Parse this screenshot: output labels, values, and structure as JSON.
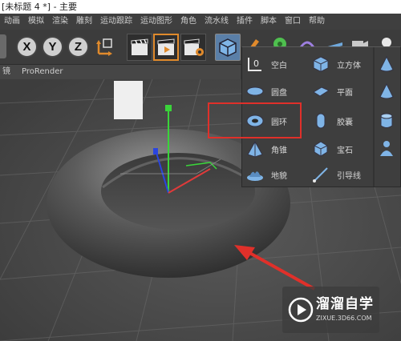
{
  "window": {
    "title": "[未标题 4 *] - 主要"
  },
  "menubar": {
    "items": [
      "动画",
      "模拟",
      "渲染",
      "雕刻",
      "运动跟踪",
      "运动图形",
      "角色",
      "流水线",
      "插件",
      "脚本",
      "窗口",
      "帮助"
    ]
  },
  "toolbar": {
    "axis_x": "X",
    "axis_y": "Y",
    "axis_z": "Z"
  },
  "subbar": {
    "left_label": "镜",
    "prorender_label": "ProRender"
  },
  "primitive_menu": {
    "col1": [
      {
        "label": "空白",
        "icon": "null-object-icon"
      },
      {
        "label": "圆盘",
        "icon": "disc-icon"
      },
      {
        "label": "圆环",
        "icon": "torus-icon"
      },
      {
        "label": "角锥",
        "icon": "pyramid-icon"
      },
      {
        "label": "地貌",
        "icon": "landscape-icon"
      }
    ],
    "col2": [
      {
        "label": "立方体",
        "icon": "cube-icon"
      },
      {
        "label": "平面",
        "icon": "plane-icon"
      },
      {
        "label": "胶囊",
        "icon": "capsule-icon"
      },
      {
        "label": "宝石",
        "icon": "gem-icon"
      },
      {
        "label": "引导线",
        "icon": "guide-icon"
      }
    ],
    "col3": [
      {
        "icon": "cone-icon"
      },
      {
        "icon": "cone-icon"
      },
      {
        "icon": "cylinder-icon"
      },
      {
        "icon": "figure-icon"
      }
    ]
  },
  "watermark": {
    "text": "溜溜自学",
    "url": "ZIXUE.3D66.COM"
  },
  "colors": {
    "highlight_red": "#e0302a",
    "accent_blue": "#4ea0e0",
    "viewport_bg": "#4a4a4a"
  }
}
